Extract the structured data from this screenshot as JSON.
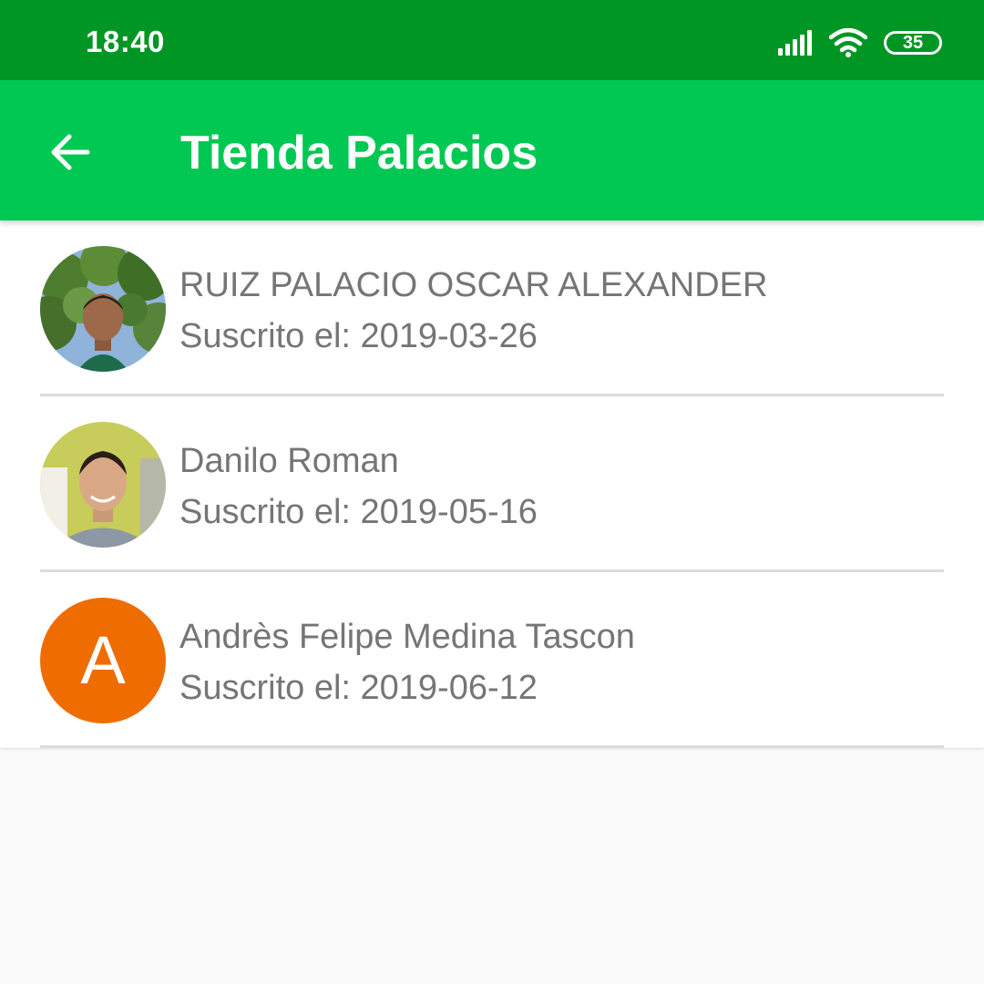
{
  "status_bar": {
    "time": "18:40",
    "battery_level": "35",
    "icons": [
      "signal-icon",
      "wifi-icon",
      "battery-icon"
    ]
  },
  "app_bar": {
    "title": "Tienda Palacios",
    "back_icon": "arrow-back-icon",
    "background_color": "#00c853",
    "status_color": "#009624"
  },
  "subscribers": [
    {
      "name": "RUIZ PALACIO OSCAR ALEXANDER",
      "subtitle": "Suscrito el: 2019-03-26",
      "avatar": "photo"
    },
    {
      "name": "Danilo Roman",
      "subtitle": "Suscrito el: 2019-05-16",
      "avatar": "photo"
    },
    {
      "name": "Andrès Felipe Medina Tascon",
      "subtitle": "Suscrito el: 2019-06-12",
      "avatar": "letter",
      "avatar_letter": "A",
      "avatar_color": "#ef6c00"
    }
  ]
}
